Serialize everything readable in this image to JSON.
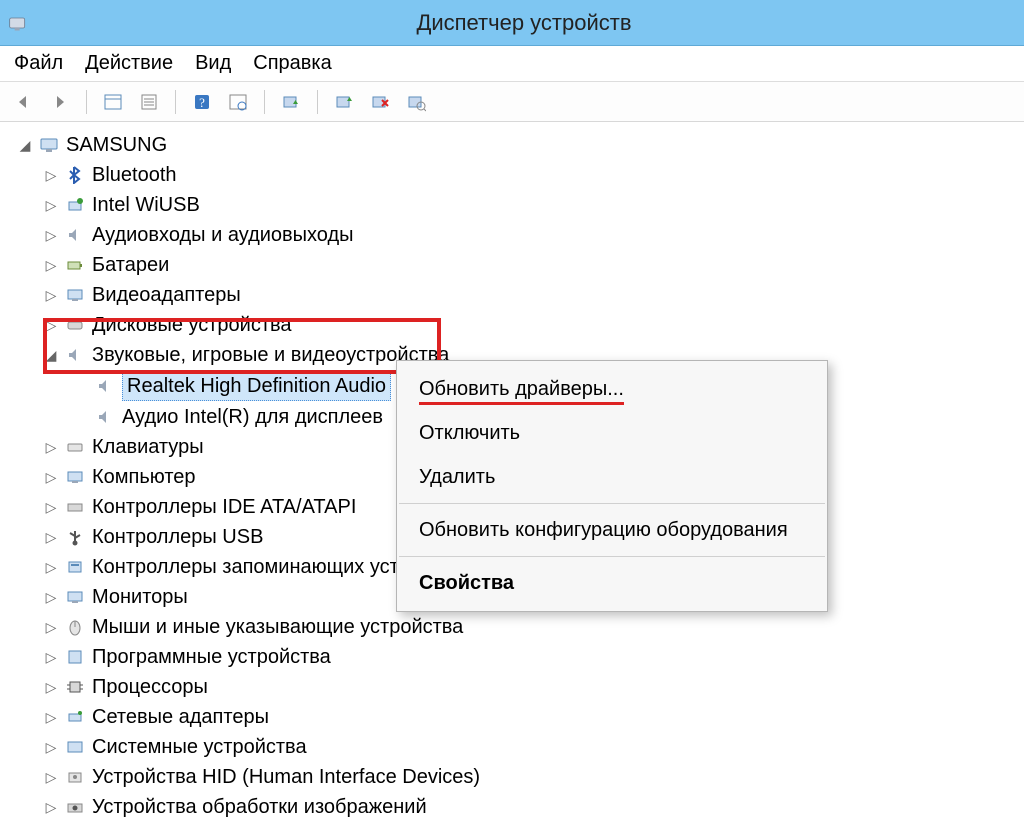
{
  "window": {
    "title": "Диспетчер устройств"
  },
  "menu": {
    "file": "Файл",
    "action": "Действие",
    "view": "Вид",
    "help": "Справка"
  },
  "tree": {
    "root": "SAMSUNG",
    "items": [
      "Bluetooth",
      "Intel WiUSB",
      "Аудиовходы и аудиовыходы",
      "Батареи",
      "Видеоадаптеры",
      "Дисковые устройства",
      "Звуковые, игровые и видеоустройства",
      "Клавиатуры",
      "Компьютер",
      "Контроллеры IDE ATA/ATAPI",
      "Контроллеры USB",
      "Контроллеры запоминающих устройств",
      "Мониторы",
      "Мыши и иные указывающие устройства",
      "Программные устройства",
      "Процессоры",
      "Сетевые адаптеры",
      "Системные устройства",
      "Устройства HID (Human Interface Devices)",
      "Устройства обработки изображений"
    ],
    "sound_children": [
      "Realtek High Definition Audio",
      "Аудио Intel(R) для дисплеев"
    ]
  },
  "context": {
    "update": "Обновить драйверы...",
    "disable": "Отключить",
    "delete": "Удалить",
    "rescan": "Обновить конфигурацию оборудования",
    "properties": "Свойства"
  }
}
